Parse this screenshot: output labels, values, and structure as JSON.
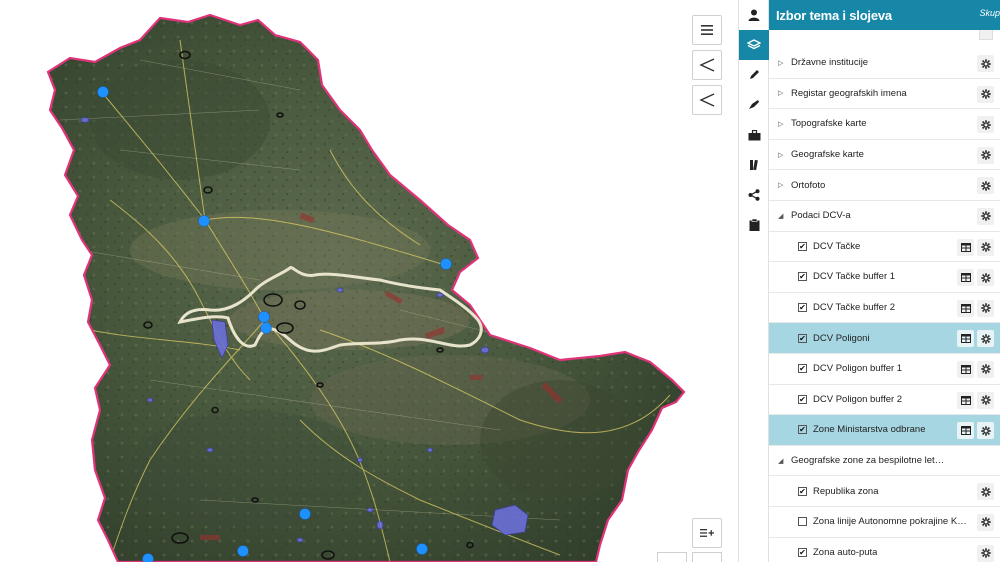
{
  "panel": {
    "title": "Izbor tema i slojeva",
    "header_link": "Skup",
    "rows": [
      {
        "type": "group",
        "expanded": false,
        "label": "Državne institucije"
      },
      {
        "type": "group",
        "expanded": false,
        "label": "Registar geografskih imena"
      },
      {
        "type": "group",
        "expanded": false,
        "label": "Topografske karte"
      },
      {
        "type": "group",
        "expanded": false,
        "label": "Geografske karte"
      },
      {
        "type": "group",
        "expanded": false,
        "label": "Ortofoto"
      },
      {
        "type": "group",
        "expanded": true,
        "label": "Podaci DCV-a"
      },
      {
        "type": "layer",
        "checked": true,
        "label": "DCV Tačke",
        "table": true,
        "selected": false
      },
      {
        "type": "layer",
        "checked": true,
        "label": "DCV Tačke buffer 1",
        "table": true,
        "selected": false
      },
      {
        "type": "layer",
        "checked": true,
        "label": "DCV Tačke buffer 2",
        "table": true,
        "selected": false
      },
      {
        "type": "layer",
        "checked": true,
        "label": "DCV Poligoni",
        "table": true,
        "selected": true
      },
      {
        "type": "layer",
        "checked": true,
        "label": "DCV Poligon buffer 1",
        "table": true,
        "selected": false
      },
      {
        "type": "layer",
        "checked": true,
        "label": "DCV Poligon buffer 2",
        "table": true,
        "selected": false
      },
      {
        "type": "layer",
        "checked": true,
        "label": "Zone Ministarstva odbrane",
        "table": true,
        "selected": true
      },
      {
        "type": "group",
        "expanded": true,
        "label": "Geografske zone za bespilotne letelice"
      },
      {
        "type": "layer",
        "checked": true,
        "label": "Republika zona",
        "table": false,
        "selected": false
      },
      {
        "type": "layer",
        "checked": false,
        "label": "Zona linije Autonomne pokrajine Kosova...",
        "table": false,
        "selected": false
      },
      {
        "type": "layer",
        "checked": true,
        "label": "Zona auto-puta",
        "table": false,
        "selected": false
      }
    ]
  },
  "toolbar": {
    "items": [
      {
        "icon": "user-icon",
        "active": false
      },
      {
        "icon": "layers-icon",
        "active": true
      },
      {
        "icon": "pencil-icon",
        "active": false
      },
      {
        "icon": "eraser-icon",
        "active": false
      },
      {
        "icon": "briefcase-icon",
        "active": false
      },
      {
        "icon": "book-icon",
        "active": false
      },
      {
        "icon": "share-icon",
        "active": false
      },
      {
        "icon": "clipboard-icon",
        "active": false
      }
    ]
  },
  "map": {
    "controls": [
      "menu-icon",
      "share-icon",
      "share-icon",
      "legend-add-icon"
    ],
    "colors": {
      "border": "#e0337a",
      "point": "#1e90ff",
      "polygon": "#6a6fd8",
      "vojvodina_boundary": "#e8e4cc",
      "roads": "#e8d66a"
    }
  },
  "colors": {
    "accent": "#1687a7",
    "selected_row": "#a7d6e3"
  }
}
